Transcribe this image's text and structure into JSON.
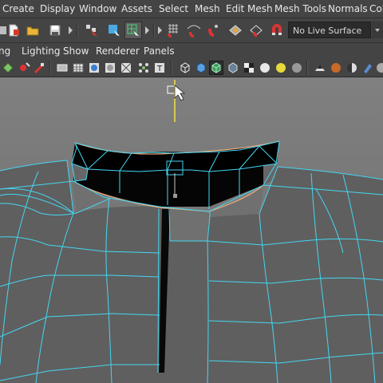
{
  "menubar": {
    "items": [
      "Create",
      "Display",
      "Window",
      "Assets",
      "Select",
      "Mesh",
      "Edit Mesh",
      "Mesh Tools",
      "Normals",
      "Col"
    ]
  },
  "toolbar": {
    "live_surface": "No Live Surface",
    "icons": [
      "new-scene-icon",
      "open-scene-icon",
      "save-scene-icon",
      "select-by-hierarchy-icon",
      "select-by-object-icon",
      "select-by-component-icon",
      "snap-to-grid-icon",
      "snap-to-curve-icon",
      "snap-to-point-icon",
      "snap-to-view-plane-icon",
      "make-live-icon",
      "magnet-icon"
    ]
  },
  "panel_menu": {
    "items": [
      "ng",
      "Lighting",
      "Show",
      "Renderer",
      "Panels"
    ]
  },
  "panel_toolbar": {
    "icons": [
      "camera-attributes-icon",
      "bookmark-icon",
      "image-plane-icon",
      "grid-icon",
      "film-gate-icon",
      "resolution-gate-icon",
      "gate-mask-icon",
      "field-chart-icon",
      "safe-action-icon",
      "text-icon",
      "wireframe-icon",
      "smooth-shade-icon",
      "wireframe-on-shaded-icon",
      "xray-icon",
      "textures-icon",
      "use-lights-icon",
      "shadows-icon",
      "screen-space-ao-icon",
      "motion-blur-icon",
      "multisample-aa-icon",
      "depth-of-field-icon"
    ]
  },
  "viewport": {
    "mesh": "shirt-collar",
    "wire_color": "#44d6f2",
    "selected_edge_color": "#f0a878",
    "manipulator_color": "#f2e24a"
  }
}
